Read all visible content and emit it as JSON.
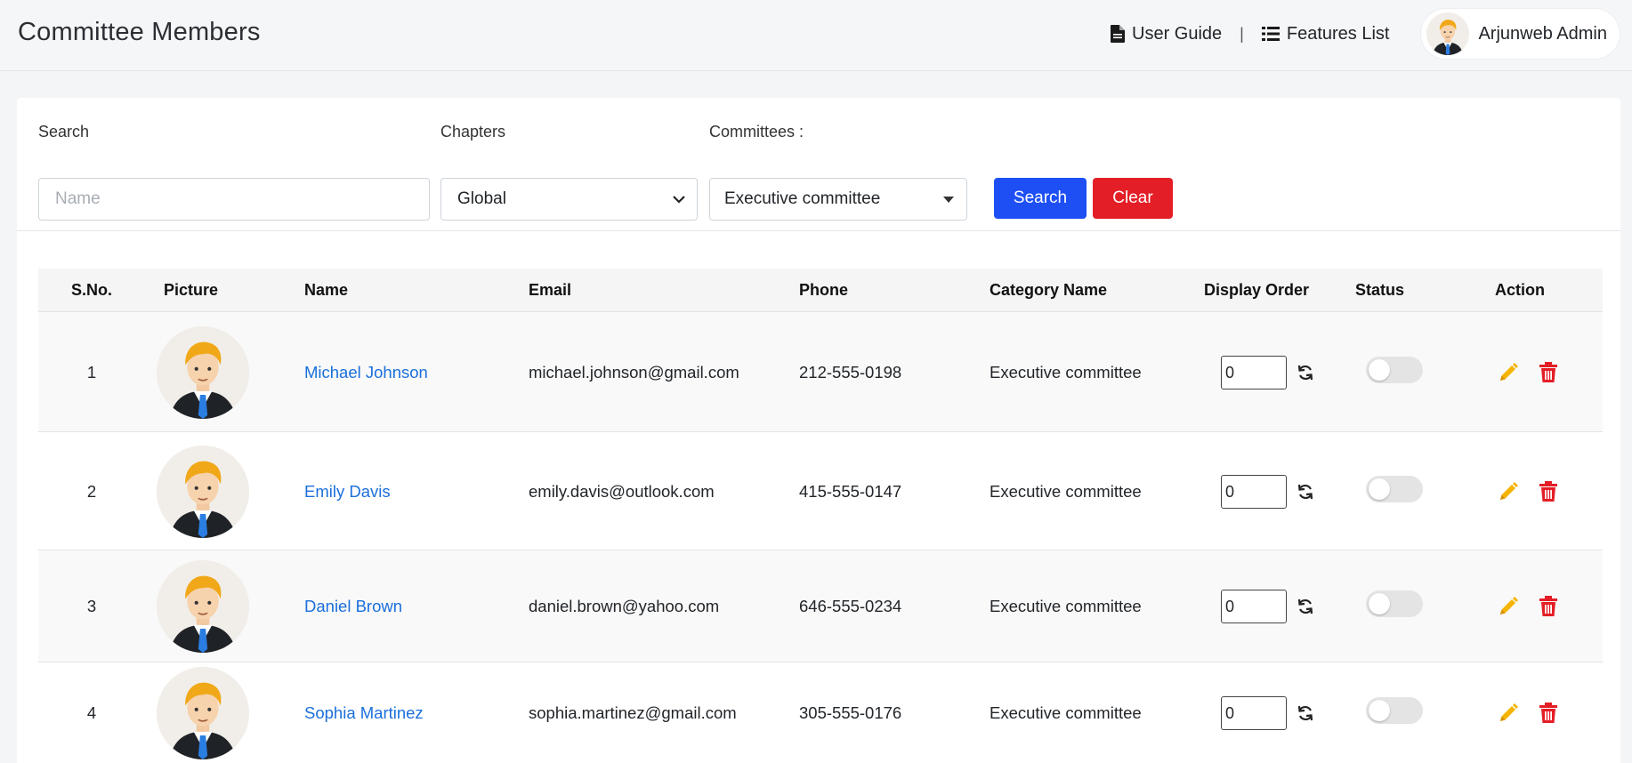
{
  "header": {
    "title": "Committee Members",
    "links": [
      {
        "label": "User Guide",
        "icon": "file-icon"
      },
      {
        "label": "Features List",
        "icon": "list-icon"
      }
    ],
    "separator": "|",
    "user": {
      "name": "Arjunweb Admin",
      "icon": "avatar"
    }
  },
  "filters": {
    "search_label": "Search",
    "search_placeholder": "Name",
    "chapters_label": "Chapters",
    "chapters_value": "Global",
    "committees_label": "Committees :",
    "committees_value": "Executive committee",
    "search_button": "Search",
    "clear_button": "Clear"
  },
  "table": {
    "columns": [
      "S.No.",
      "Picture",
      "Name",
      "Email",
      "Phone",
      "Category Name",
      "Display Order",
      "Status",
      "Action"
    ],
    "rows": [
      {
        "sno": "1",
        "name": "Michael Johnson",
        "email": "michael.johnson@gmail.com",
        "phone": "212-555-0198",
        "category": "Executive committee",
        "order": "0"
      },
      {
        "sno": "2",
        "name": "Emily Davis",
        "email": "emily.davis@outlook.com",
        "phone": "415-555-0147",
        "category": "Executive committee",
        "order": "0"
      },
      {
        "sno": "3",
        "name": "Daniel Brown",
        "email": "daniel.brown@yahoo.com",
        "phone": "646-555-0234",
        "category": "Executive committee",
        "order": "0"
      },
      {
        "sno": "4",
        "name": "Sophia Martinez",
        "email": "sophia.martinez@gmail.com",
        "phone": "305-555-0176",
        "category": "Executive committee",
        "order": "0"
      }
    ]
  },
  "colors": {
    "primary": "#1d4ff5",
    "danger": "#e41e26",
    "link": "#1a6fdb",
    "edit": "#f5b400"
  }
}
